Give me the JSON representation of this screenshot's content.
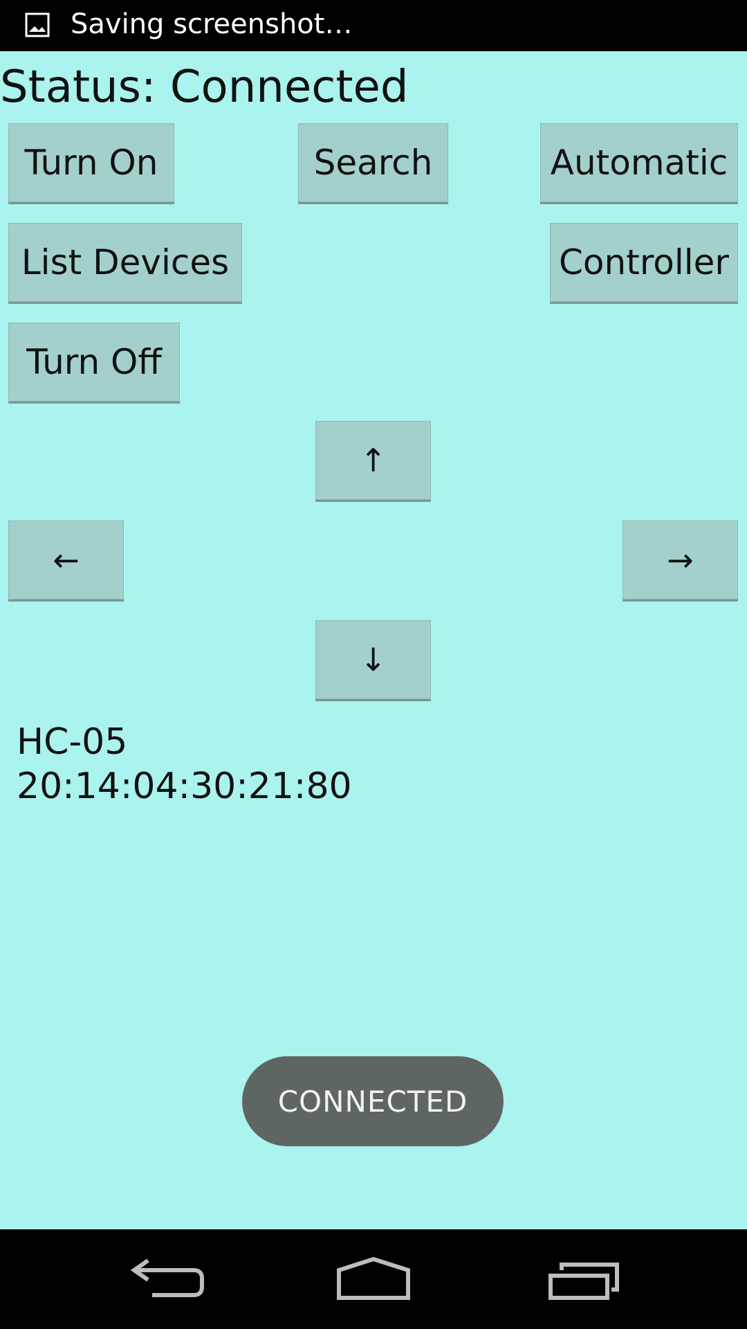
{
  "status_bar": {
    "notification_text": "Saving screenshot…",
    "icon": "image-icon"
  },
  "app": {
    "status_label": "Status: Connected",
    "buttons": {
      "turn_on": "Turn On",
      "search": "Search",
      "automatic": "Automatic",
      "list_devices": "List Devices",
      "controller": "Controller",
      "turn_off": "Turn Off"
    },
    "arrows": {
      "up": "↑",
      "left": "←",
      "right": "→",
      "down": "↓"
    },
    "device": {
      "name": "HC-05",
      "address": "20:14:04:30:21:80"
    },
    "toast": "CONNECTED"
  },
  "nav_bar": {
    "icons": [
      "back-icon",
      "home-icon",
      "recents-icon"
    ]
  },
  "colors": {
    "background": "#aaf3ee",
    "button": "#a3d0cb",
    "toast": "#5e6664",
    "bars": "#000000"
  }
}
